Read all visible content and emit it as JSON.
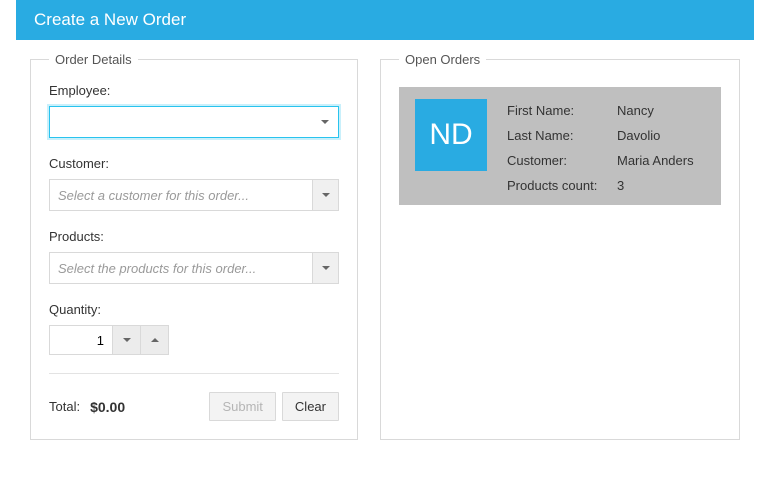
{
  "header": {
    "title": "Create a New Order"
  },
  "orderDetails": {
    "legend": "Order Details",
    "employee": {
      "label": "Employee:",
      "value": ""
    },
    "customer": {
      "label": "Customer:",
      "placeholder": "Select a customer for this order..."
    },
    "products": {
      "label": "Products:",
      "placeholder": "Select the products for this order..."
    },
    "quantity": {
      "label": "Quantity:",
      "value": "1"
    },
    "total": {
      "label": "Total:",
      "value": "$0.00"
    },
    "buttons": {
      "submit": "Submit",
      "clear": "Clear"
    }
  },
  "openOrders": {
    "legend": "Open Orders",
    "card": {
      "initials": "ND",
      "rows": [
        {
          "label": "First Name:",
          "value": "Nancy"
        },
        {
          "label": "Last Name:",
          "value": "Davolio"
        },
        {
          "label": "Customer:",
          "value": "Maria Anders"
        },
        {
          "label": "Products count:",
          "value": "3"
        }
      ]
    }
  }
}
